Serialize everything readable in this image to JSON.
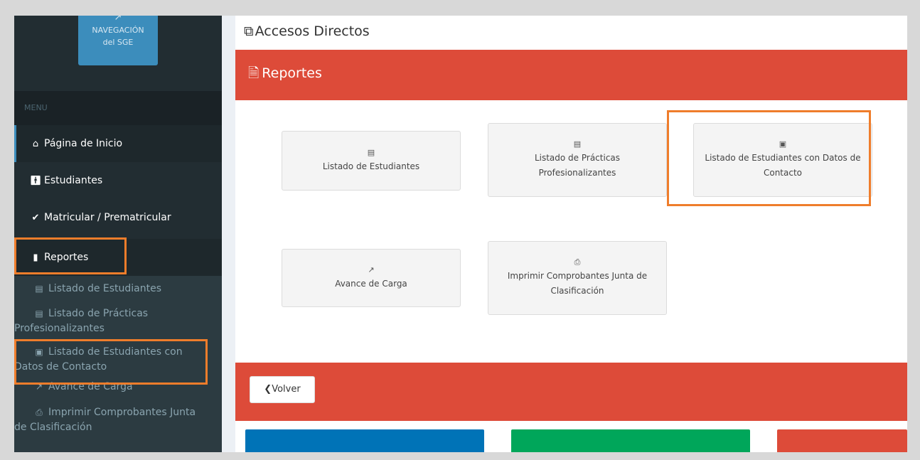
{
  "sidebar": {
    "nav_button": {
      "icon": "external-link-icon",
      "line1": "NAVEGACIÓN",
      "line2": "del SGE"
    },
    "menu_header": "MENU",
    "items": [
      {
        "label": "Página de Inicio",
        "icon": "home-icon"
      },
      {
        "label": "Estudiantes",
        "icon": "male-icon"
      },
      {
        "label": "Matricular / Prematricular",
        "icon": "check-icon"
      },
      {
        "label": "Reportes",
        "icon": "file-icon"
      }
    ],
    "submenu": [
      {
        "label": "Listado de Estudiantes",
        "icon": "list-alt-icon"
      },
      {
        "label_1": "Listado de Prácticas",
        "label_2": "Profesionalizantes",
        "icon": "list-alt-icon"
      },
      {
        "label_1": "Listado de Estudiantes con",
        "label_2": "Datos de Contacto",
        "icon": "address-card-icon"
      },
      {
        "label": "Avance de Carga",
        "icon": "line-chart-icon"
      },
      {
        "label_1": "Imprimir Comprobantes Junta",
        "label_2": "de Clasificación",
        "icon": "print-icon"
      }
    ]
  },
  "content": {
    "title": "Accesos Directos",
    "box_title": "Reportes",
    "cards": [
      {
        "label_1": "Listado de Estudiantes",
        "label_2": "",
        "icon": "list-alt-icon"
      },
      {
        "label_1": "Listado de Prácticas",
        "label_2": "Profesionalizantes",
        "icon": "list-alt-icon"
      },
      {
        "label_1": "Listado de Estudiantes con Datos de",
        "label_2": "Contacto",
        "icon": "address-card-icon"
      },
      {
        "label_1": "Avance de Carga",
        "label_2": "",
        "icon": "line-chart-icon"
      },
      {
        "label_1": "Imprimir Comprobantes Junta de",
        "label_2": "Clasificación",
        "icon": "print-icon"
      }
    ],
    "back_button": "Volver"
  },
  "colors": {
    "sidebar_bg": "#222d32",
    "accent_red": "#dd4b39",
    "accent_blue": "#3c8dbc",
    "highlight": "#ef7d2b",
    "tile_blue": "#0073b7",
    "tile_green": "#00a65a",
    "tile_red": "#dd4b39"
  }
}
